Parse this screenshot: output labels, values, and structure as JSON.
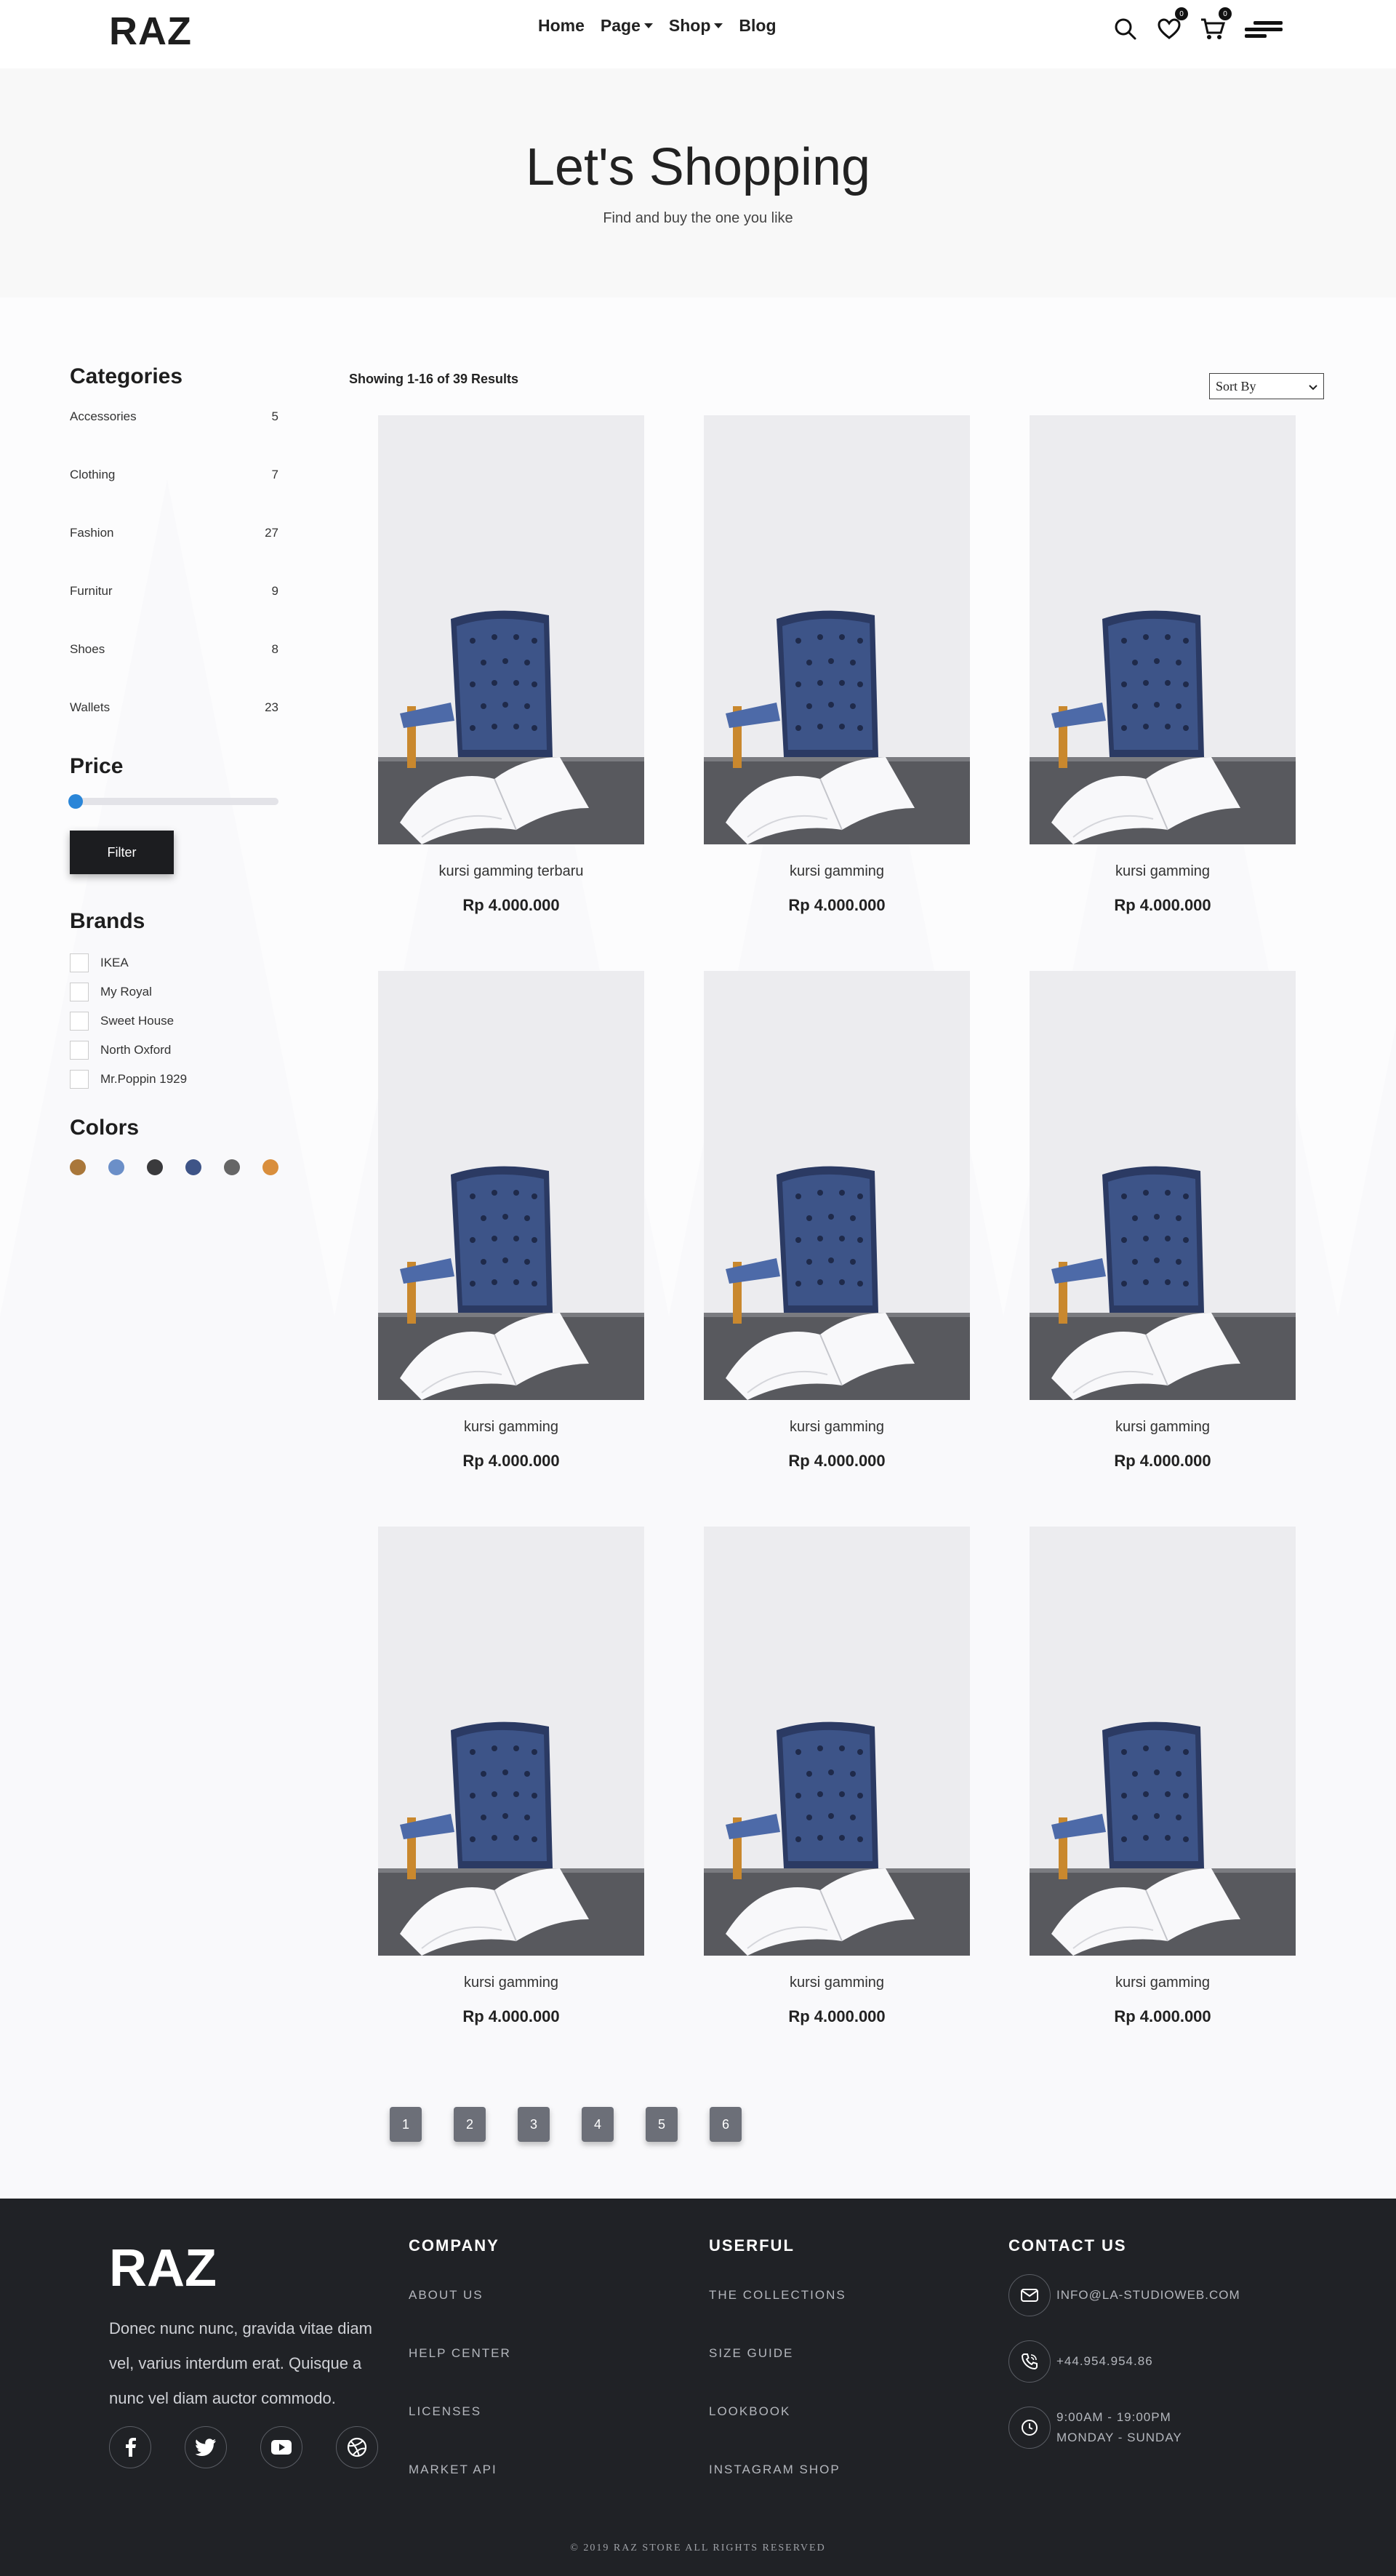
{
  "brand": "RAZ",
  "nav": [
    {
      "label": "Home",
      "dropdown": false
    },
    {
      "label": "Page",
      "dropdown": true
    },
    {
      "label": "Shop",
      "dropdown": true
    },
    {
      "label": "Blog",
      "dropdown": false
    }
  ],
  "header_icons": {
    "wishlist_count": "0",
    "cart_count": "0"
  },
  "hero": {
    "title": "Let's Shopping",
    "subtitle": "Find and buy the one you like"
  },
  "sidebar": {
    "categories_title": "Categories",
    "categories": [
      {
        "name": "Accessories",
        "count": "5"
      },
      {
        "name": "Clothing",
        "count": "7"
      },
      {
        "name": "Fashion",
        "count": "27"
      },
      {
        "name": "Furnitur",
        "count": "9"
      },
      {
        "name": "Shoes",
        "count": "8"
      },
      {
        "name": "Wallets",
        "count": "23"
      }
    ],
    "price_title": "Price",
    "price_slider_value": 0,
    "filter_label": "Filter",
    "brands_title": "Brands",
    "brands": [
      "IKEA",
      "My Royal",
      "Sweet House",
      "North Oxford",
      "Mr.Poppin 1929"
    ],
    "colors_title": "Colors",
    "colors": [
      "#a9773a",
      "#6b8fc8",
      "#3a3a3c",
      "#3e5487",
      "#666666",
      "#d98e3c"
    ]
  },
  "main": {
    "results": "Showing 1-16 of 39 Results",
    "sort_label": "Sort By",
    "products": [
      {
        "name": "kursi gamming terbaru",
        "price": "Rp 4.000.000"
      },
      {
        "name": "kursi gamming",
        "price": "Rp 4.000.000"
      },
      {
        "name": "kursi gamming",
        "price": "Rp 4.000.000"
      },
      {
        "name": "kursi gamming",
        "price": "Rp 4.000.000"
      },
      {
        "name": "kursi gamming",
        "price": "Rp 4.000.000"
      },
      {
        "name": "kursi gamming",
        "price": "Rp 4.000.000"
      },
      {
        "name": "kursi gamming",
        "price": "Rp 4.000.000"
      },
      {
        "name": "kursi gamming",
        "price": "Rp 4.000.000"
      },
      {
        "name": "kursi gamming",
        "price": "Rp 4.000.000"
      }
    ],
    "pages": [
      "1",
      "2",
      "3",
      "4",
      "5",
      "6"
    ]
  },
  "footer": {
    "logo": "RAZ",
    "about": "Donec nunc nunc, gravida vitae diam vel, varius interdum erat. Quisque a nunc vel diam auctor commodo.",
    "social": [
      "facebook-icon",
      "twitter-icon",
      "youtube-icon",
      "dribbble-icon"
    ],
    "company_title": "COMPANY",
    "company_links": [
      "ABOUT US",
      "HELP CENTER",
      "LICENSES",
      "MARKET API"
    ],
    "userful_title": "USERFUL",
    "userful_links": [
      "THE COLLECTIONS",
      "SIZE GUIDE",
      "LOOKBOOK",
      "INSTAGRAM SHOP"
    ],
    "contact_title": "CONTACT US",
    "email": "INFO@LA-STUDIOWEB.COM",
    "phone": "+44.954.954.86",
    "hours_line1": "9:00AM - 19:00PM",
    "hours_line2": "MONDAY - SUNDAY",
    "copyright": "© 2019 RAZ STORE ALL RIGHTS RESERVED"
  }
}
